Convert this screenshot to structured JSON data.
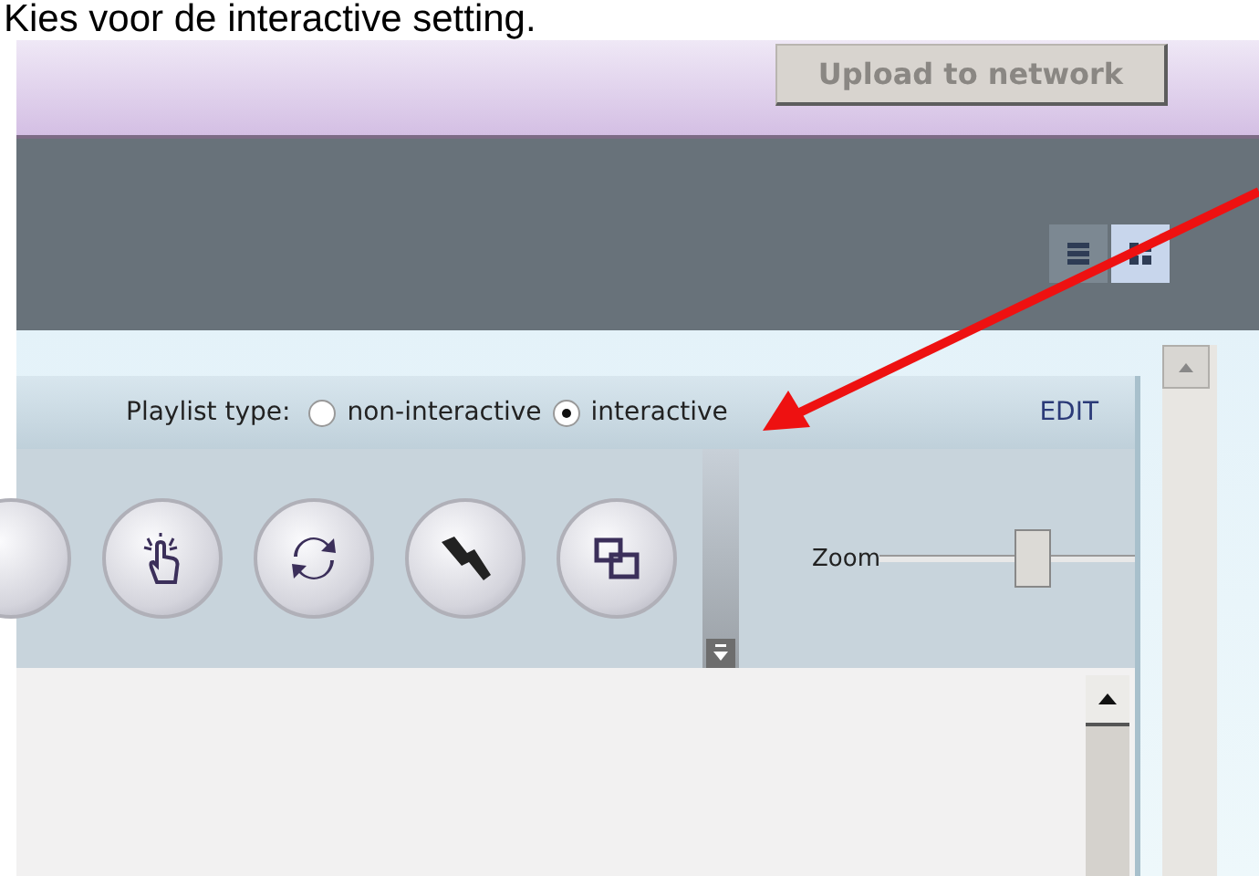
{
  "caption": "Kies voor de interactive setting.",
  "upload_button": "Upload to network",
  "view_buttons": [
    {
      "kind": "list",
      "selected": false
    },
    {
      "kind": "grid",
      "selected": true
    }
  ],
  "playlist_type": {
    "label": "Playlist type:",
    "options": [
      {
        "label": "non-interactive",
        "selected": false
      },
      {
        "label": "interactive",
        "selected": true
      }
    ],
    "edit": "EDIT"
  },
  "zoom": {
    "label": "Zoom",
    "level": 0.6
  }
}
